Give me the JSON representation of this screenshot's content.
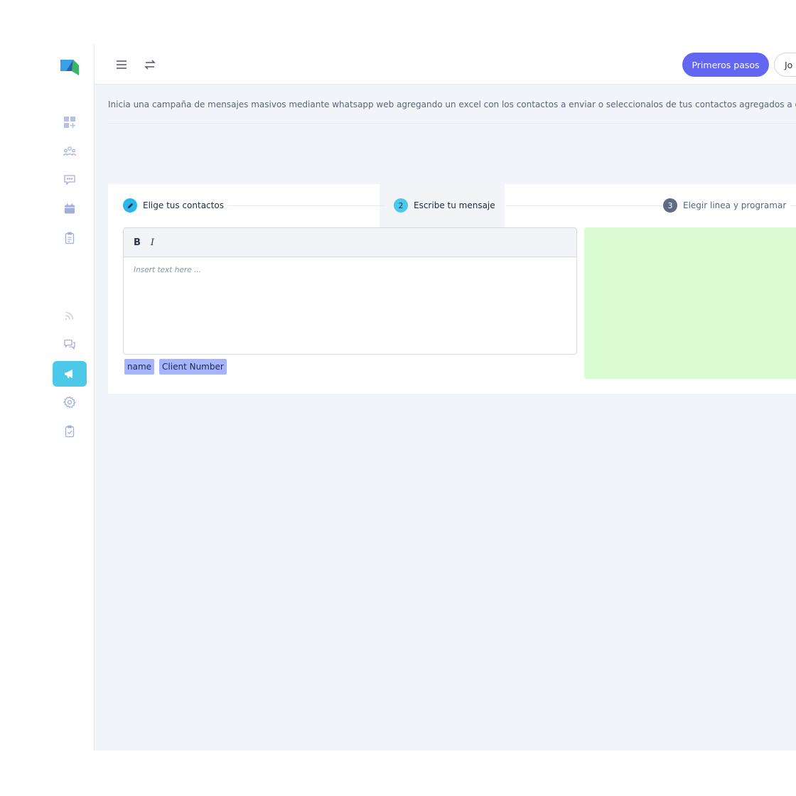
{
  "topbar": {
    "primary_button": "Primeros pasos",
    "user_button": "Jo"
  },
  "description": "Inicia una campaña de mensajes masivos mediante whatsapp web agregando un excel con los contactos a enviar o seleccionalos de tus contactos agregados a digybot",
  "steps": [
    {
      "number": "",
      "label": "Elige tus contactos",
      "state": "done"
    },
    {
      "number": "2",
      "label": "Escribe tu mensaje",
      "state": "active"
    },
    {
      "number": "3",
      "label": "Elegir linea y programar",
      "state": "pending"
    }
  ],
  "editor": {
    "bold_label": "B",
    "italic_label": "I",
    "placeholder": "Insert text here ..."
  },
  "tags": [
    "name",
    "Client Number"
  ],
  "colors": {
    "accent": "#6366f1",
    "active_nav": "#4cc9e9",
    "nav_icon": "#a3aede",
    "preview_bg": "#d9fcd2",
    "tag_bg": "#a5b4fc"
  },
  "sidebar": {
    "items": [
      {
        "icon": "dashboard-add-icon"
      },
      {
        "icon": "users-icon"
      },
      {
        "icon": "chat-bubble-icon"
      },
      {
        "icon": "calendar-icon"
      },
      {
        "icon": "clipboard-list-icon"
      },
      {
        "icon": "rss-icon"
      },
      {
        "icon": "conversations-icon"
      },
      {
        "icon": "megaphone-icon",
        "active": true
      },
      {
        "icon": "settings-gear-icon"
      },
      {
        "icon": "clipboard-check-icon"
      }
    ]
  }
}
